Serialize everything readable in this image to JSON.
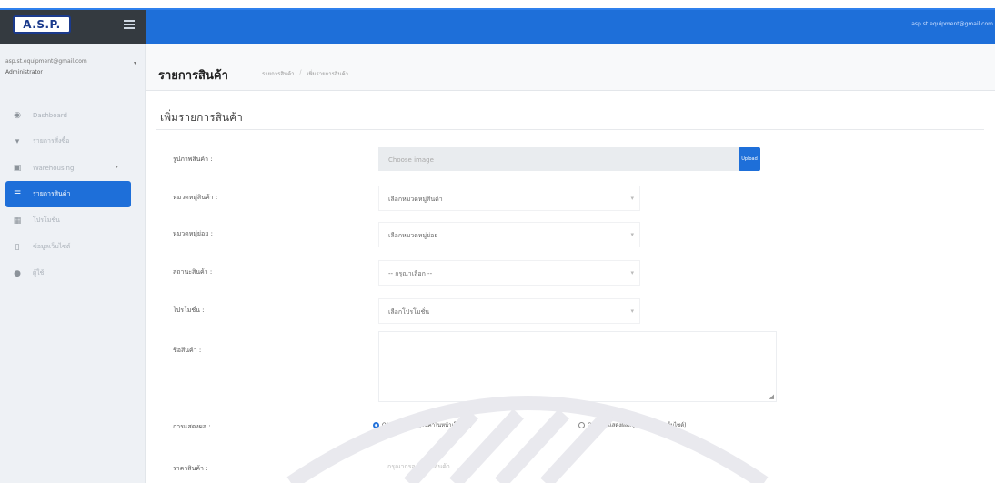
{
  "header": {
    "logo_text": "A.S.P.",
    "user_email": "asp.st.equipment@gmail.com"
  },
  "sidebar": {
    "user_email": "asp.st.equipment@gmail.com",
    "user_role": "Administrator",
    "items": [
      {
        "icon": "dashboard-icon",
        "label": "Dashboard",
        "glyph": "◉"
      },
      {
        "icon": "cart-icon",
        "label": "รายการสั่งซื้อ",
        "glyph": "▾"
      },
      {
        "icon": "inventory-icon",
        "label": "Warehousing",
        "glyph": "▣"
      },
      {
        "icon": "list-icon",
        "label": "รายการสินค้า",
        "glyph": "☰"
      },
      {
        "icon": "news-icon",
        "label": "โปรโมชั่น",
        "glyph": "▦"
      },
      {
        "icon": "mobile-icon",
        "label": "ข้อมูลเว็บไซต์",
        "glyph": "▯"
      },
      {
        "icon": "user-icon",
        "label": "ผู้ใช้",
        "glyph": "●"
      }
    ]
  },
  "content": {
    "page_title": "รายการสินค้า",
    "breadcrumb": [
      "รายการสินค้า",
      "เพิ่มรายการสินค้า"
    ],
    "card_title": "เพิ่มรายการสินค้า"
  },
  "form": {
    "image_label": "รูปภาพสินค้า :",
    "image_placeholder": "Choose image",
    "upload_label": "Upload",
    "category_label": "หมวดหมู่สินค้า :",
    "category_value": "เลือกหมวดหมู่สินค้า",
    "subcategory_label": "หมวดหมู่ย่อย :",
    "subcategory_value": "เลือกหมวดหมู่ย่อย",
    "status_label": "สถานะสินค้า :",
    "status_value": "-- กรุณาเลือก --",
    "promo_label": "โปรโมชั่น :",
    "promo_value": "เลือกโปรโมชั่น",
    "name_label": "ชื่อสินค้า :",
    "display_label": "การแสดงผล :",
    "display_on": "ON (แสดงผลหมู่สินค้าในหน้าเว็บไซต์)",
    "display_off": "OFF (ไม่แสดงผลหมู่สินค้าในหน้าเว็บไซต์)",
    "price_label": "ราคาสินค้า :",
    "price_placeholder": "กรุณากรอกราคาสินค้า"
  }
}
